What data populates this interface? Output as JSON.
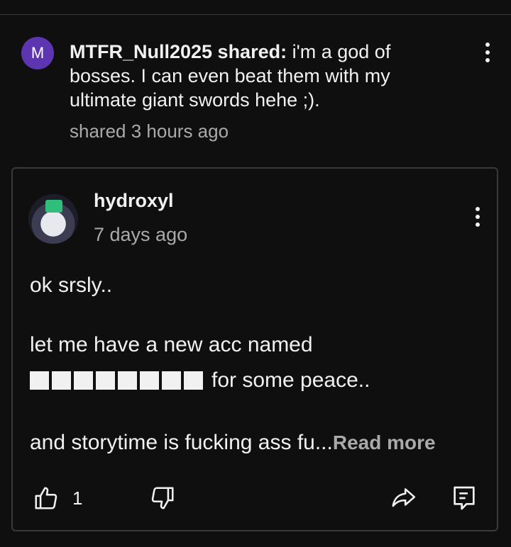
{
  "share": {
    "avatar_letter": "M",
    "author": "MTFR_Null2025 shared:",
    "text": " i'm a god of bosses. I can even beat them with my ultimate giant swords hehe ;).",
    "time": "shared 3 hours ago"
  },
  "comment": {
    "author": "hydroxyl",
    "time": "7 days ago",
    "line1": "ok srsly..",
    "line2": "let me have a new acc named",
    "line3_suffix": "for some peace..",
    "line4": "and storytime is fucking ass fu...",
    "read_more": "Read more",
    "like_count": "1",
    "censored_block_count": 8
  },
  "icons": {
    "share_menu": "more-vert-icon",
    "comment_menu": "more-vert-icon",
    "like": "thumbs-up-icon",
    "dislike": "thumbs-down-icon",
    "share": "share-icon",
    "reply": "reply-icon"
  },
  "colors": {
    "background": "#0f0f0f",
    "avatar_purple": "#5e35b1",
    "secondary_text": "#aaaaaa",
    "border": "#3a3a3a"
  }
}
